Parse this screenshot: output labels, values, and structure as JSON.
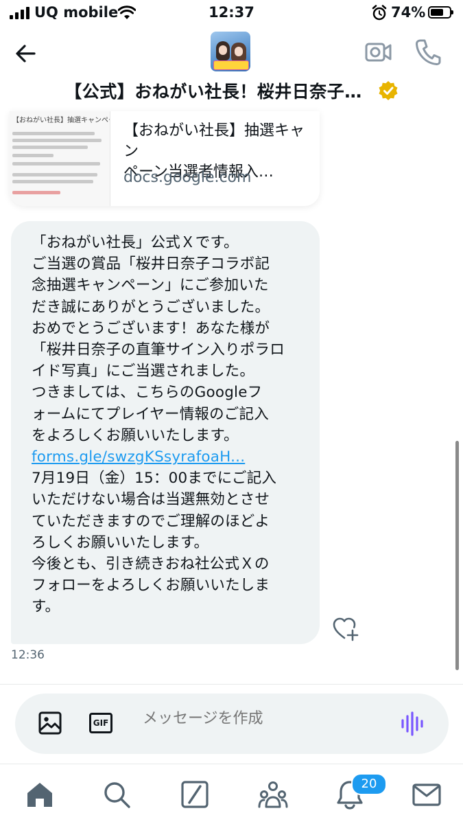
{
  "status_bar": {
    "carrier": "UQ mobile",
    "time": "12:37",
    "battery": "74%",
    "battery_level": 0.74
  },
  "header": {
    "title": "【公式】おねがい社長！桜井日奈子…",
    "verified_color": "#e8b400"
  },
  "link_card": {
    "thumbnail_heading": "【おねがい社長】抽選キャンペーン当選者情報入力フォーム",
    "title": "【おねがい社長】抽選キャン\nペーン当選者情報入…",
    "domain": "docs.google.com"
  },
  "message": {
    "text_before_link": "「おねがい社長」公式Ｘです。\nご当選の賞品「桜井日奈子コラボ記\n念抽選キャンペーン」にご参加いた\nだき誠にありがとうございました。\nおめでとうございます！あなた様が\n「桜井日奈子の直筆サイン入りポラロ\nイド写真」にご当選されました。\nつきましては、こちらのGoogleフ\nォームにてプレイヤー情報のご記入\nをよろしくお願いいたします。",
    "link": "forms.gle/swzgKSsyrafoaH...",
    "text_after_link": "7月19日（金）15：00までにご記入\nいただけない場合は当選無効とさせ\nていただきますのでご理解のほどよ\nろしくお願いいたします。\n今後とも、引き続きおね社公式Ｘの\nフォローをよろしくお願いいたしま\nす。",
    "time": "12:36"
  },
  "composer": {
    "placeholder": "メッセージを作成",
    "gif_label": "GIF"
  },
  "nav": {
    "notifications_count": "20"
  },
  "colors": {
    "accent": "#1d9bf0",
    "voice": "#7856ff",
    "bubble": "#eff3f4"
  }
}
